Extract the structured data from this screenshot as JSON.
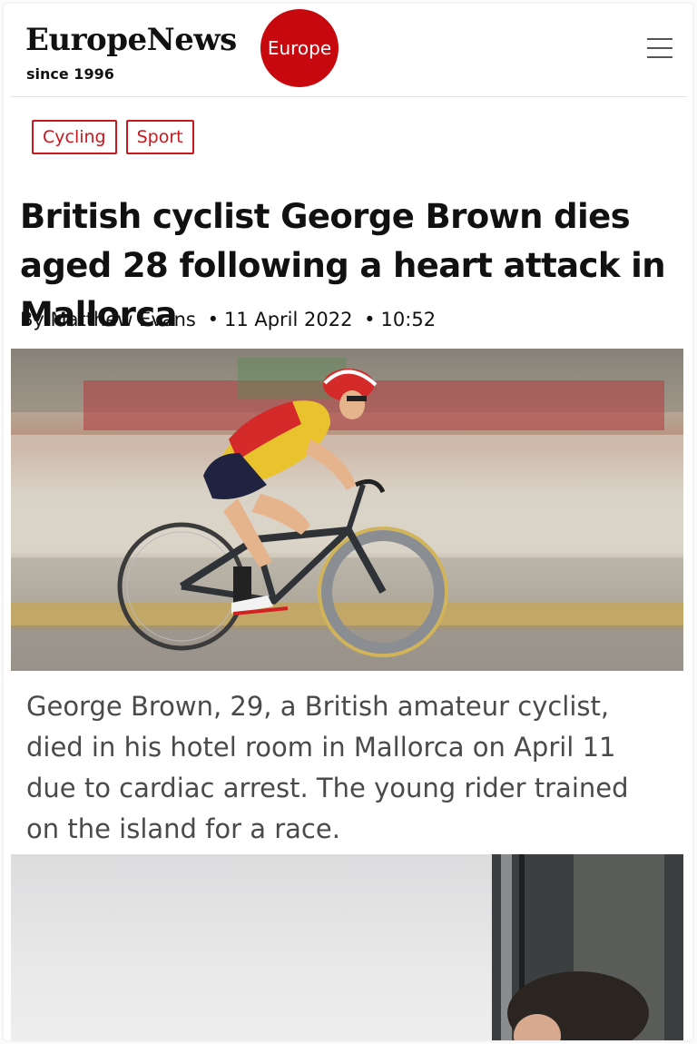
{
  "header": {
    "brand": "EuropeNews",
    "since": "since 1996",
    "region_badge": "Europe",
    "menu_icon": "hamburger-menu-icon"
  },
  "tags": [
    "Cycling",
    "Sport"
  ],
  "article": {
    "headline": "British cyclist George Brown dies aged 28 following a heart attack in Mallorca",
    "author": "By Matthew Evans",
    "date": "11 April 2022",
    "time": "10:52",
    "summary": "George Brown, 29, a British amateur cyclist, died in his hotel room in Mallorca on April 11 due to cardiac arrest. The young rider trained on the island for a race."
  },
  "colors": {
    "accent_red": "#c8080f",
    "tag_red": "#c8171d",
    "summary_gray": "#4a4a4a"
  }
}
